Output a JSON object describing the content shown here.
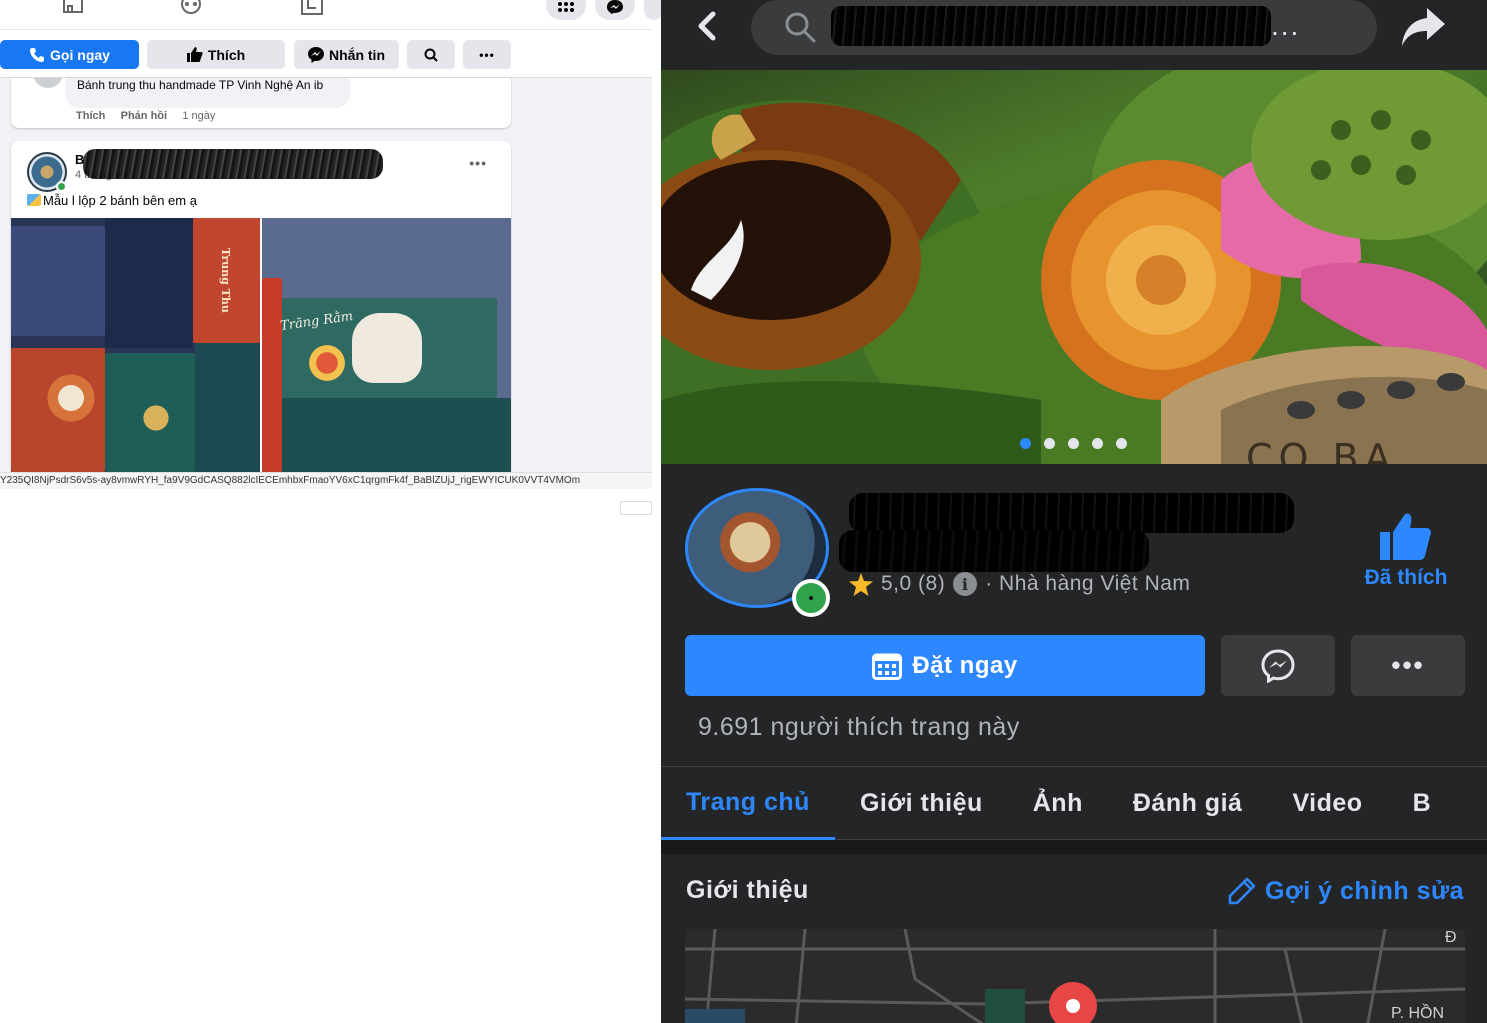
{
  "left_panel": {
    "action_bar": {
      "call_now": "Gọi ngay",
      "like": "Thích",
      "message": "Nhắn tin"
    },
    "comment": {
      "text": "Bánh trung thu handmade TP Vinh Nghệ An ib",
      "like": "Thích",
      "reply": "Phản hồi",
      "time": "1 ngày"
    },
    "post": {
      "page_name_prefix": "B",
      "time": "4 tháng 9 lú",
      "caption": "Mẫu l lộp 2 bánh bên em ạ",
      "more": "•••",
      "photo1_text": "Trung Thu",
      "photo2_text": "Trăng Rằm"
    },
    "status_url": "Y235QI8NjPsdrS6v5s-ay8vmwRYH_fa9V9GdCASQ882lcIECEmhbxFmaoYV6xC1qrgmFk4f_BaBlZUjJ_rigEWYICUK0VVT4VMOm"
  },
  "right_panel": {
    "search": {
      "dots": "..."
    },
    "cover": {
      "watermark": "CO BA",
      "slides": 5,
      "active_slide": 1
    },
    "profile": {
      "rating": "5,0 (8)",
      "category": "· Nhà hàng Việt Nam",
      "liked_label": "Đã thích"
    },
    "buttons": {
      "book": "Đặt ngay",
      "more": "•••"
    },
    "likes_count": "9.691 người thích trang này",
    "tabs": [
      "Trang chủ",
      "Giới thiệu",
      "Ảnh",
      "Đánh giá",
      "Video",
      "B"
    ],
    "intro": {
      "title": "Giới thiệu",
      "suggest_edit": "Gợi ý chỉnh sửa",
      "map_label_1": "P. HỒN",
      "map_label_2": "Đ"
    }
  },
  "colors": {
    "fb_blue": "#1877f2",
    "dark_bg": "#242526",
    "dark_accent": "#2d88ff",
    "online_green": "#31a24c"
  }
}
